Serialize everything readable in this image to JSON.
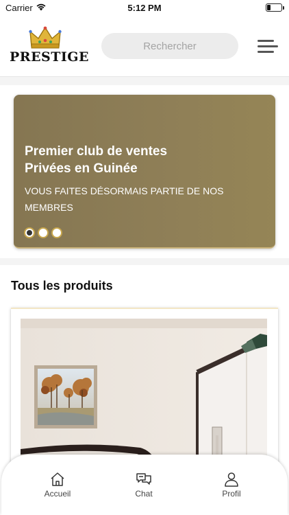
{
  "status_bar": {
    "carrier": "Carrier",
    "time": "5:12 PM",
    "battery_level": 0.15
  },
  "header": {
    "logo_text": "PRESTIGE",
    "search_placeholder": "Rechercher",
    "menu_icon": "menu-icon"
  },
  "banner": {
    "title": "Premier club de ventes\nPrivées en Guinée",
    "subtitle": "VOUS FAITES DÉSORMAIS PARTIE DE NOS MEMBRES",
    "slides": 3,
    "active_slide": 1,
    "colors": {
      "background": "#8b7c55",
      "dot_border": "#c8a74d"
    }
  },
  "products": {
    "section_title": "Tous les produits"
  },
  "bottom_nav": {
    "items": [
      {
        "label": "Accueil",
        "icon": "home-icon"
      },
      {
        "label": "Chat",
        "icon": "chat-icon"
      },
      {
        "label": "Profil",
        "icon": "user-icon"
      }
    ]
  }
}
